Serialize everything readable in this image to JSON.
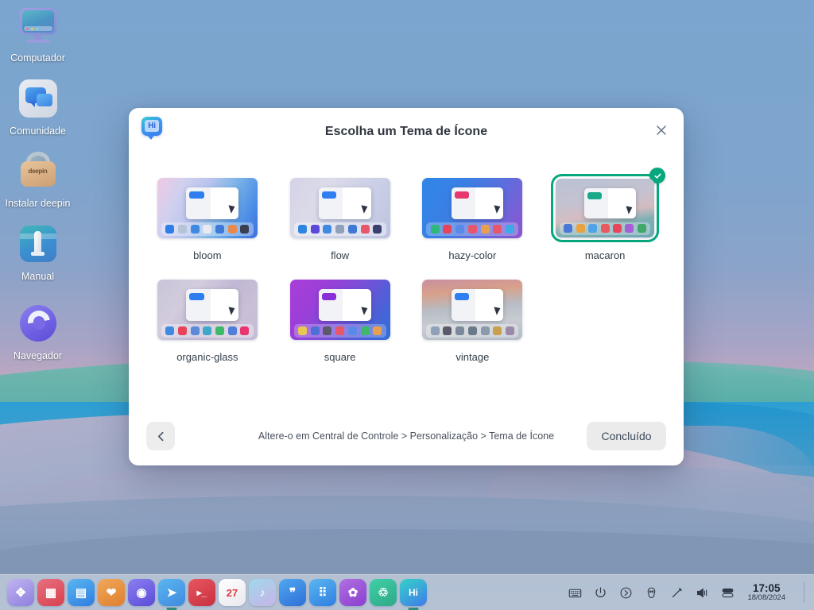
{
  "desktop": {
    "icons": [
      {
        "label": "Computador",
        "name": "computer"
      },
      {
        "label": "Comunidade",
        "name": "community"
      },
      {
        "label": "Instalar deepin",
        "name": "install-deepin"
      },
      {
        "label": "Manual",
        "name": "manual"
      },
      {
        "label": "Navegador",
        "name": "browser"
      }
    ]
  },
  "dialog": {
    "title": "Escolha um Tema de Ícone",
    "app_icon_text": "Hi",
    "close_label": "×",
    "footer": {
      "hint": "Altere-o em Central de Controle > Personalização > Tema de Ícone",
      "back_label": "‹",
      "done_label": "Concluído"
    },
    "selected_theme": "macaron",
    "themes": [
      {
        "name": "bloom",
        "label": "bloom",
        "selected": false,
        "bg": "linear-gradient(115deg,#efc9e2 0%,#cfd0ef 22%,#b9c4ee 42%,#7fb6e8 62%,#4d8fe6 84%,#3f6fdd 100%)",
        "pill": "#2f7ef0",
        "dock_bg": "rgba(255,255,255,0.34)",
        "dock_colors": [
          "#2f7ee8",
          "#b7c3d6",
          "#3f8ae0",
          "#e8eaf0",
          "#3f79d8",
          "#e88a4e",
          "#3b3f52"
        ]
      },
      {
        "name": "flow",
        "label": "flow",
        "selected": false,
        "bg": "linear-gradient(120deg,#d4d2e6 0%,#dcdbe9 30%,#cfd2e8 55%,#c6cbe4 80%,#bcc3e0 100%)",
        "pill": "#2f7ef0",
        "dock_bg": "rgba(255,255,255,0.42)",
        "dock_colors": [
          "#2f86e0",
          "#5b4ad8",
          "#3f8ae0",
          "#8fa0b8",
          "#3f79d8",
          "#e8566a",
          "#3b3f6e"
        ]
      },
      {
        "name": "hazy-color",
        "label": "hazy-color",
        "selected": false,
        "bg": "linear-gradient(120deg,#2f86e8 0%,#3b7fe4 35%,#5a6fdd 62%,#7a5fd6 85%,#8a55cf 100%)",
        "pill": "#e8366f",
        "dock_bg": "rgba(255,255,255,0.26)",
        "dock_colors": [
          "#2fb878",
          "#e8435a",
          "#5a8ae8",
          "#e8566a",
          "#e8a04e",
          "#e8566a",
          "#3fa8e8"
        ]
      },
      {
        "name": "macaron",
        "label": "macaron",
        "selected": true,
        "bg": "linear-gradient(170deg,#b9c2d4 0%,#c5c2d0 38%,#d4bcc0 58%,#7fb0b4 74%,#6fa8b4 100%)",
        "pill": "#18a98a",
        "dock_bg": "rgba(255,255,255,0.3)",
        "dock_colors": [
          "#4a78d8",
          "#e8a33f",
          "#4fa3e8",
          "#e85a5f",
          "#e8445a",
          "#a65fd8",
          "#3fa86a"
        ]
      },
      {
        "name": "organic-glass",
        "label": "organic-glass",
        "selected": false,
        "bg": "linear-gradient(130deg,#c9c4d8 0%,#d2ccdd 30%,#c0b8d4 55%,#cbbfd6 78%,#c4bcd6 100%)",
        "pill": "#2f7ef0",
        "dock_bg": "rgba(255,255,255,0.36)",
        "dock_colors": [
          "#3f8ae0",
          "#e8435a",
          "#5a8ad8",
          "#3fa8c8",
          "#3fb86a",
          "#4f7fd8",
          "#e8356f"
        ]
      },
      {
        "name": "square",
        "label": "square",
        "selected": false,
        "bg": "linear-gradient(125deg,#a93fd8 0%,#9a3fd8 28%,#7a4fd8 52%,#4f5fd8 76%,#2f6fd8 100%)",
        "pill": "#8a2fd8",
        "dock_bg": "rgba(255,255,255,0.26)",
        "dock_colors": [
          "#e8c84e",
          "#4f6fd8",
          "#5a5a6a",
          "#e8566a",
          "#5a8ae8",
          "#3fb86a",
          "#e8a04e"
        ]
      },
      {
        "name": "vintage",
        "label": "vintage",
        "selected": false,
        "bg": "linear-gradient(175deg,#c98fa0 0%,#d8a08a 22%,#b8bcc4 46%,#c8ccd2 70%,#b4bcc6 100%)",
        "pill": "#2f7ef0",
        "dock_bg": "rgba(255,255,255,0.34)",
        "dock_colors": [
          "#8fa0b8",
          "#5a5a6a",
          "#7a8a9a",
          "#6a7a8a",
          "#8a9aaa",
          "#c8a04e",
          "#9a8aa8"
        ]
      }
    ]
  },
  "taskbar": {
    "apps": [
      {
        "name": "launcher",
        "glyph": "✥",
        "bg": "linear-gradient(150deg,#c0b4f0,#8f7fe0)",
        "running": false
      },
      {
        "name": "app-store",
        "glyph": "▦",
        "bg": "linear-gradient(150deg,#e8707f,#d8404f)",
        "running": false
      },
      {
        "name": "file-manager",
        "glyph": "▤",
        "bg": "linear-gradient(150deg,#5ab6f0,#2f7ee0)",
        "running": false
      },
      {
        "name": "app-market",
        "glyph": "❤",
        "bg": "linear-gradient(150deg,#f0a85a,#e07f2f)",
        "running": false
      },
      {
        "name": "browser",
        "glyph": "◉",
        "bg": "linear-gradient(150deg,#8b7ff0,#5b4bd8)",
        "running": false
      },
      {
        "name": "mail",
        "glyph": "➤",
        "bg": "linear-gradient(150deg,#5ab6f0,#3f8ae0)",
        "running": true
      },
      {
        "name": "terminal",
        "glyph": "▸_",
        "bg": "linear-gradient(150deg,#e8565f,#c83040)",
        "running": false
      },
      {
        "name": "calendar",
        "glyph": "27",
        "bg": "linear-gradient(150deg,#ffffff,#e8e8ee)",
        "running": false
      },
      {
        "name": "music",
        "glyph": "♪",
        "bg": "linear-gradient(150deg,#9fd8ea,#c8b4e8)",
        "running": false
      },
      {
        "name": "notes",
        "glyph": "❞",
        "bg": "linear-gradient(150deg,#4fa8f0,#2f6fd8)",
        "running": false
      },
      {
        "name": "calculator",
        "glyph": "⠿",
        "bg": "linear-gradient(150deg,#5ab6f0,#2f7ee0)",
        "running": false
      },
      {
        "name": "settings",
        "glyph": "✿",
        "bg": "linear-gradient(150deg,#b06fe0,#8a3fd0)",
        "running": false
      },
      {
        "name": "trash",
        "glyph": "♲",
        "bg": "linear-gradient(150deg,#3fd0a8,#2fa888)",
        "running": false
      },
      {
        "name": "hi-app",
        "glyph": "Hi",
        "bg": "linear-gradient(150deg,#34d2c8,#3f7bea)",
        "running": true
      }
    ],
    "tray": [
      {
        "name": "keyboard-layout-icon"
      },
      {
        "name": "power-icon"
      },
      {
        "name": "shutdown-menu-icon"
      },
      {
        "name": "onboarding-icon"
      },
      {
        "name": "brightness-icon"
      },
      {
        "name": "volume-icon"
      },
      {
        "name": "notification-icon"
      }
    ],
    "clock": {
      "time": "17:05",
      "date": "18/08/2024"
    }
  },
  "colors": {
    "accent_teal": "#06a77d",
    "dialog_bg": "#ffffff",
    "taskbar_bg": "#b7c4d6"
  }
}
